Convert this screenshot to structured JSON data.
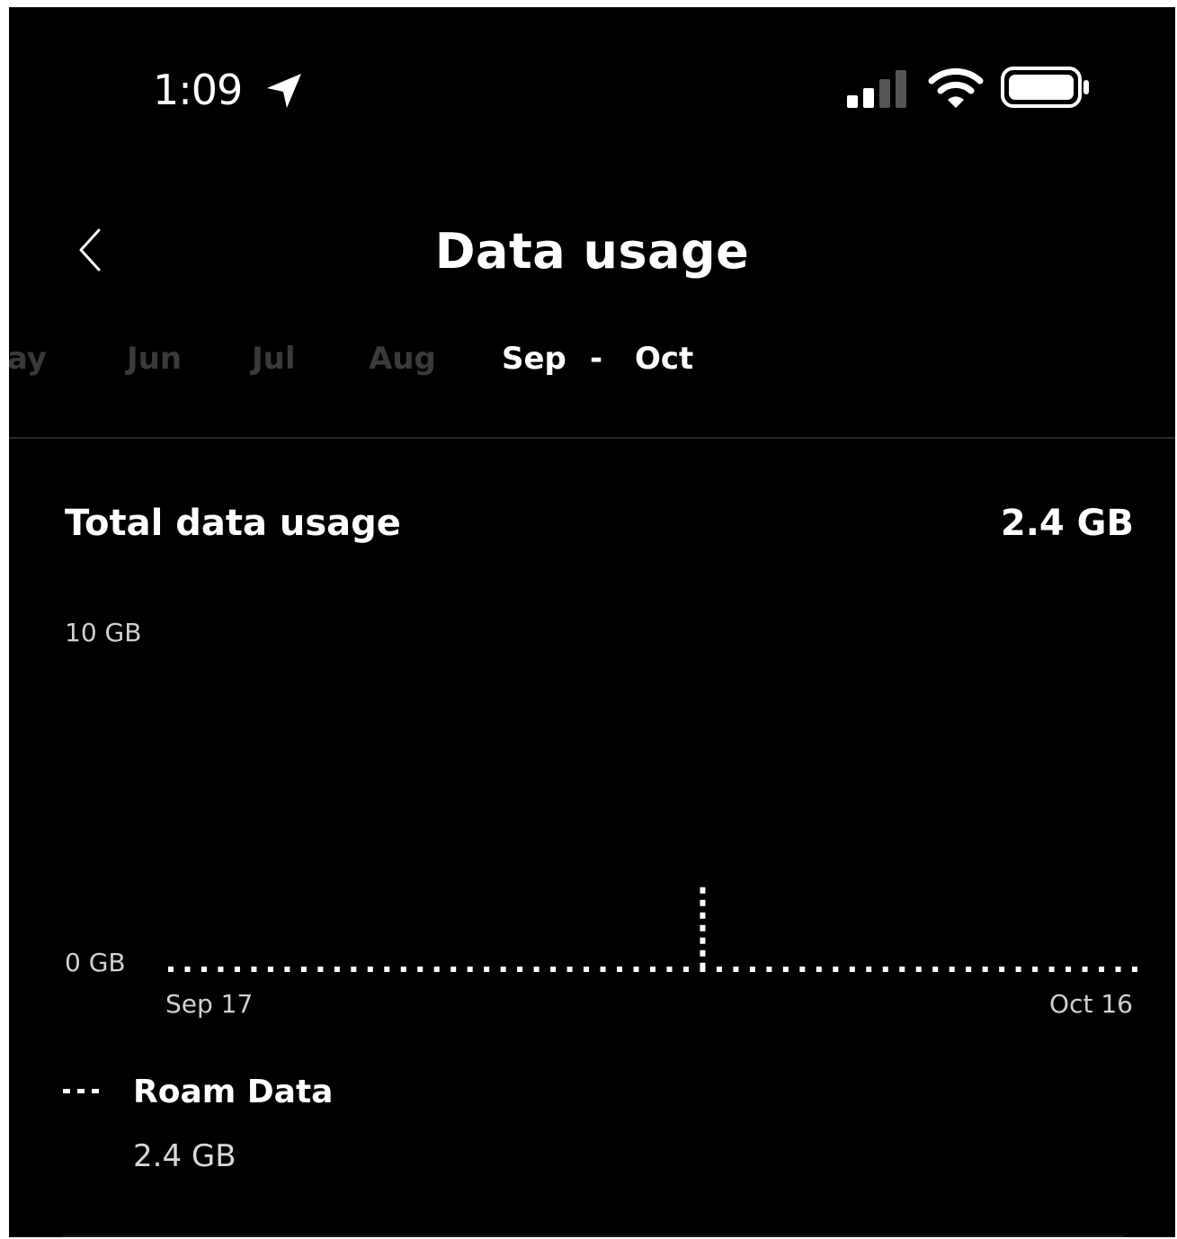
{
  "status_bar": {
    "time": "1:09",
    "icons": [
      "location-arrow-icon",
      "cellular-signal-icon",
      "wifi-icon",
      "battery-icon"
    ]
  },
  "header": {
    "back_icon": "chevron-left-icon",
    "title": "Data usage"
  },
  "months": {
    "items": [
      "May",
      "Jun",
      "Jul",
      "Aug"
    ],
    "selected_start": "Sep",
    "separator": "-",
    "selected_end": "Oct"
  },
  "total": {
    "label": "Total data usage",
    "value": "2.4 GB"
  },
  "chart_data": {
    "type": "line",
    "y_tick_labels": [
      "10 GB",
      "0 GB"
    ],
    "ylim": [
      0,
      10
    ],
    "x_tick_labels": [
      "Sep 17",
      "Oct 16"
    ],
    "x": [
      "Sep 17",
      "Sep 18",
      "Sep 19",
      "Sep 20",
      "Sep 21",
      "Sep 22",
      "Sep 23",
      "Sep 24",
      "Sep 25",
      "Sep 26",
      "Sep 27",
      "Sep 28",
      "Sep 29",
      "Sep 30",
      "Oct 1",
      "Oct 2",
      "Oct 3",
      "Oct 4",
      "Oct 5",
      "Oct 6",
      "Oct 7",
      "Oct 8",
      "Oct 9",
      "Oct 10",
      "Oct 11",
      "Oct 12",
      "Oct 13",
      "Oct 14",
      "Oct 15",
      "Oct 16"
    ],
    "series": [
      {
        "name": "Roam Data",
        "values": [
          0,
          0,
          0,
          0,
          0,
          0,
          0,
          0,
          0,
          0,
          0,
          0,
          0,
          0,
          0,
          0,
          2.4,
          0,
          0,
          0,
          0,
          0,
          0,
          0,
          0,
          0,
          0,
          0,
          0,
          0
        ],
        "style": "dotted",
        "color": "#ffffff"
      }
    ],
    "grid": false
  },
  "legend": {
    "name": "Roam Data",
    "value": "2.4 GB"
  },
  "colors": {
    "background": "#000000",
    "text": "#ffffff",
    "inactive_month": "#3a3a3a"
  }
}
